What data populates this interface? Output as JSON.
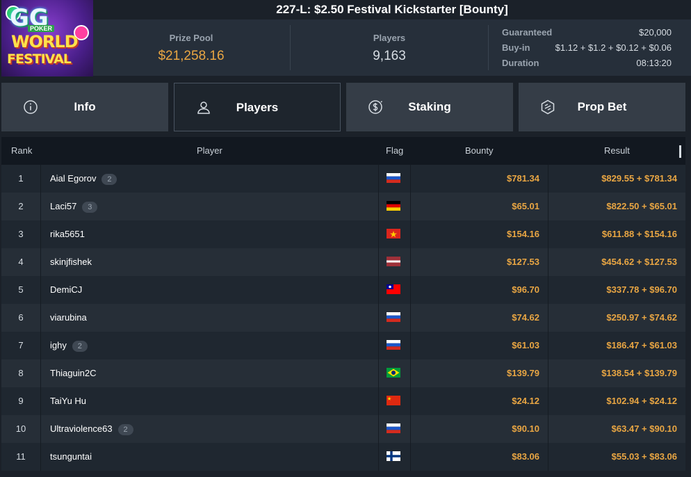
{
  "tournament": {
    "title": "227-L: $2.50 Festival Kickstarter [Bounty]",
    "logo": {
      "top": "GG",
      "poker": "POKER",
      "line1": "WORLD",
      "line2": "FESTIVAL"
    },
    "prize_pool_label": "Prize Pool",
    "prize_pool": "$21,258.16",
    "players_label": "Players",
    "players": "9,163",
    "details": [
      {
        "label": "Guaranteed",
        "value": "$20,000"
      },
      {
        "label": "Buy-in",
        "value": "$1.12 + $1.2 + $0.12 + $0.06"
      },
      {
        "label": "Duration",
        "value": "08:13:20"
      }
    ]
  },
  "tabs": [
    {
      "label": "Info",
      "icon": "info-icon",
      "active": false
    },
    {
      "label": "Players",
      "icon": "user-icon",
      "active": true
    },
    {
      "label": "Staking",
      "icon": "dollar-coin-icon",
      "active": false
    },
    {
      "label": "Prop Bet",
      "icon": "prop-bet-icon",
      "active": false
    }
  ],
  "table": {
    "headers": {
      "rank": "Rank",
      "player": "Player",
      "flag": "Flag",
      "bounty": "Bounty",
      "result": "Result"
    },
    "rows": [
      {
        "rank": "1",
        "player": "Aial Egorov",
        "badge": "2",
        "flag": "ru",
        "bounty": "$781.34",
        "result": "$829.55 + $781.34"
      },
      {
        "rank": "2",
        "player": "Laci57",
        "badge": "3",
        "flag": "de",
        "bounty": "$65.01",
        "result": "$822.50 + $65.01"
      },
      {
        "rank": "3",
        "player": "rika5651",
        "badge": "",
        "flag": "vn",
        "bounty": "$154.16",
        "result": "$611.88 + $154.16"
      },
      {
        "rank": "4",
        "player": "skinjfishek",
        "badge": "",
        "flag": "lv",
        "bounty": "$127.53",
        "result": "$454.62 + $127.53"
      },
      {
        "rank": "5",
        "player": "DemiCJ",
        "badge": "",
        "flag": "tw",
        "bounty": "$96.70",
        "result": "$337.78 + $96.70"
      },
      {
        "rank": "6",
        "player": "viarubina",
        "badge": "",
        "flag": "ru",
        "bounty": "$74.62",
        "result": "$250.97 + $74.62"
      },
      {
        "rank": "7",
        "player": "ighy",
        "badge": "2",
        "flag": "ru",
        "bounty": "$61.03",
        "result": "$186.47 + $61.03"
      },
      {
        "rank": "8",
        "player": "Thiaguin2C",
        "badge": "",
        "flag": "br",
        "bounty": "$139.79",
        "result": "$138.54 + $139.79"
      },
      {
        "rank": "9",
        "player": "TaiYu Hu",
        "badge": "",
        "flag": "cn",
        "bounty": "$24.12",
        "result": "$102.94 + $24.12"
      },
      {
        "rank": "10",
        "player": "Ultraviolence63",
        "badge": "2",
        "flag": "ru",
        "bounty": "$90.10",
        "result": "$63.47 + $90.10"
      },
      {
        "rank": "11",
        "player": "tsunguntai",
        "badge": "",
        "flag": "fi",
        "bounty": "$83.06",
        "result": "$55.03 + $83.06"
      }
    ]
  },
  "colors": {
    "accent": "#e9a643",
    "background": "#1b2129",
    "panel": "#262f3a",
    "tab": "#353d47"
  }
}
